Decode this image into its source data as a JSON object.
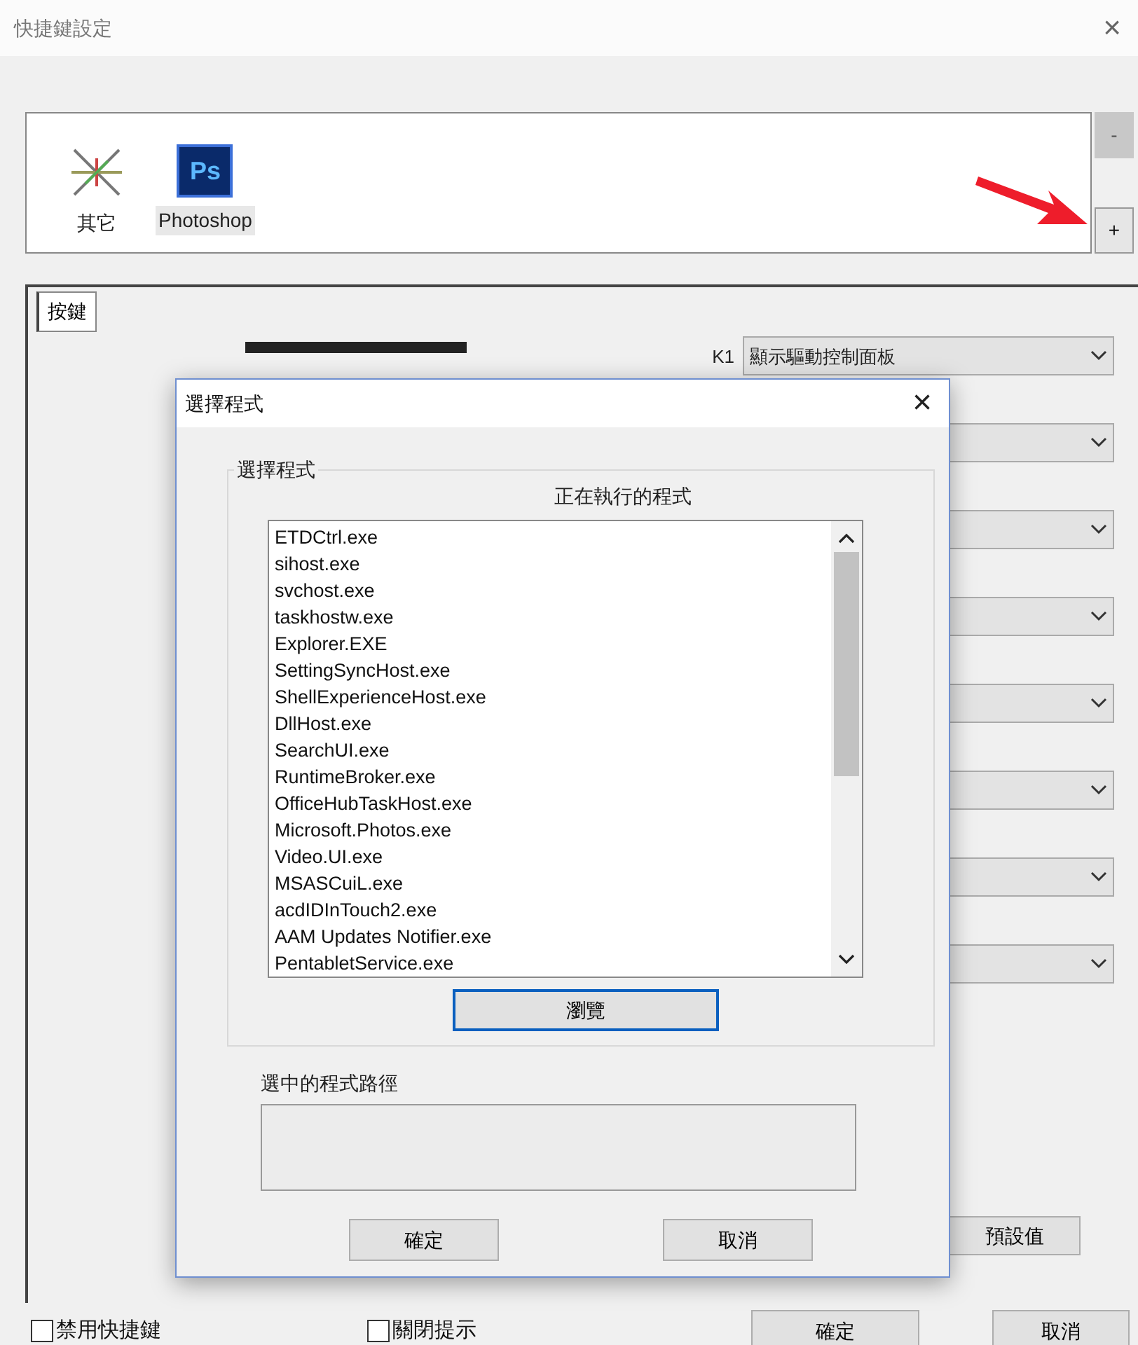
{
  "window": {
    "title": "快捷鍵設定",
    "close": "×"
  },
  "applications": [
    {
      "label": "其它",
      "selected": false,
      "kind": "generic"
    },
    {
      "label": "Photoshop",
      "selected": true,
      "kind": "photoshop",
      "badge": "Ps"
    }
  ],
  "app_buttons": [
    {
      "label": "-",
      "disabled": true
    },
    {
      "label": "+",
      "disabled": false
    }
  ],
  "tabs": [
    {
      "label": "按鍵",
      "selected": true
    }
  ],
  "dropdowns": [
    {
      "kind": "labeled",
      "key": "K1",
      "value": "顯示驅動控制面板"
    },
    {
      "kind": "covered"
    },
    {
      "kind": "covered"
    },
    {
      "kind": "covered"
    },
    {
      "kind": "covered"
    },
    {
      "kind": "covered"
    },
    {
      "kind": "covered"
    },
    {
      "kind": "covered"
    }
  ],
  "default_button": "預設值",
  "options": [
    {
      "label": "禁用快捷鍵",
      "checked": false
    },
    {
      "label": "關閉提示",
      "checked": false
    }
  ],
  "ok": "確定",
  "cancel": "取消",
  "dialog": {
    "title": "選擇程式",
    "close": "×",
    "group_title": "選擇程式",
    "list_heading": "正在執行的程式",
    "programs": [
      {
        "name": "ETDCtrl.exe",
        "selected": false
      },
      {
        "name": "sihost.exe",
        "selected": false
      },
      {
        "name": "svchost.exe",
        "selected": false
      },
      {
        "name": "taskhostw.exe",
        "selected": false
      },
      {
        "name": "Explorer.EXE",
        "selected": false
      },
      {
        "name": "SettingSyncHost.exe",
        "selected": false
      },
      {
        "name": "ShellExperienceHost.exe",
        "selected": false
      },
      {
        "name": "DllHost.exe",
        "selected": false
      },
      {
        "name": "SearchUI.exe",
        "selected": false
      },
      {
        "name": "RuntimeBroker.exe",
        "selected": false
      },
      {
        "name": "OfficeHubTaskHost.exe",
        "selected": false
      },
      {
        "name": "Microsoft.Photos.exe",
        "selected": false
      },
      {
        "name": "Video.UI.exe",
        "selected": false
      },
      {
        "name": "MSASCuiL.exe",
        "selected": false
      },
      {
        "name": "acdIDInTouch2.exe",
        "selected": false
      },
      {
        "name": "AAM Updates Notifier.exe",
        "selected": false
      },
      {
        "name": "PentabletService.exe",
        "selected": false
      }
    ],
    "browse": "瀏覽",
    "path_label": "選中的程式路徑",
    "ok": "確定",
    "cancel": "取消"
  }
}
